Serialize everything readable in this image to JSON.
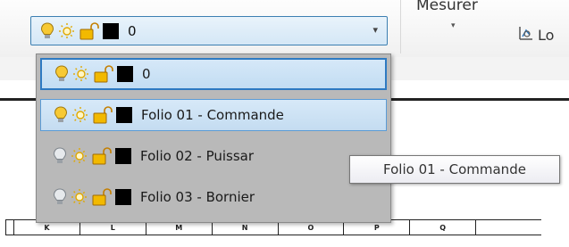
{
  "ribbon": {
    "measure_label": "Mesurer",
    "measure_arrow": "▾",
    "lo_label": "Lo",
    "lo_icon": "measure-area-icon"
  },
  "layer_combo": {
    "selected_label": "0",
    "arrow": "▾"
  },
  "layers": [
    {
      "label": "0",
      "bulb": "on"
    },
    {
      "label": "Folio 01 - Commande",
      "bulb": "on"
    },
    {
      "label": "Folio 02 - Puissar",
      "bulb": "off"
    },
    {
      "label": "Folio 03 - Bornier",
      "bulb": "off"
    }
  ],
  "tooltip": {
    "text": "Folio 01 - Commande"
  },
  "ruler_columns": [
    "",
    "K",
    "L",
    "M",
    "N",
    "O",
    "P",
    "Q",
    ""
  ],
  "colors": {
    "bulb_on": "#f7c934",
    "bulb_off": "#cfd3d8",
    "sun": "#f2b900",
    "lock": "#e8a600",
    "selection_border": "#2e7ac2"
  }
}
